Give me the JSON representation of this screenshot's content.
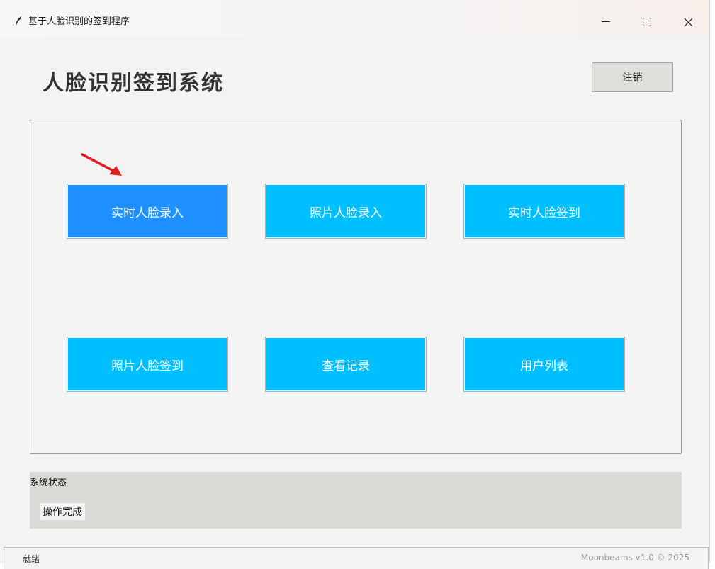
{
  "window": {
    "title": "基于人脸识别的签到程序",
    "controls": {
      "minimize": "—",
      "maximize": "☐",
      "close": "✕"
    }
  },
  "header": {
    "title": "人脸识别签到系统",
    "logout_label": "注销"
  },
  "actions": [
    {
      "label": "实时人脸录入",
      "active": true
    },
    {
      "label": "照片人脸录入",
      "active": false
    },
    {
      "label": "实时人脸签到",
      "active": false
    },
    {
      "label": "照片人脸签到",
      "active": false
    },
    {
      "label": "查看记录",
      "active": false
    },
    {
      "label": "用户列表",
      "active": false
    }
  ],
  "status": {
    "label": "系统状态",
    "value": "操作完成"
  },
  "footer": {
    "left": "就绪",
    "right": "Moonbeams v1.0 © 2025"
  },
  "colors": {
    "button": "#00bfff",
    "button_active": "#1e90ff",
    "arrow": "#e02020"
  }
}
